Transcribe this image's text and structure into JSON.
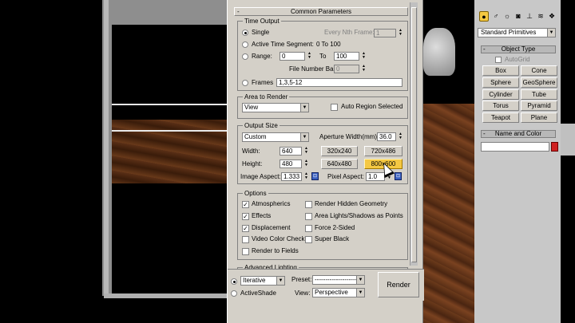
{
  "dialog": {
    "rollout_title": "Common Parameters",
    "rollout_toggle": "-",
    "time_output": {
      "title": "Time Output",
      "single": "Single",
      "every_nth_frame_label": "Every Nth Frame:",
      "every_nth_frame_value": "1",
      "active_time_segment": "Active Time Segment:",
      "active_range": "0 To 100",
      "range": "Range:",
      "range_from": "0",
      "range_to_label": "To",
      "range_to": "100",
      "file_number_base_label": "File Number Base:",
      "file_number_base_value": "0",
      "frames": "Frames",
      "frames_value": "1,3,5-12"
    },
    "area_to_render": {
      "title": "Area to Render",
      "selected": "View",
      "auto_region": "Auto Region Selected"
    },
    "output_size": {
      "title": "Output Size",
      "preset": "Custom",
      "aperture_label": "Aperture Width(mm):",
      "aperture_value": "36.0",
      "width_label": "Width:",
      "width_value": "640",
      "height_label": "Height:",
      "height_value": "480",
      "btn_320": "320x240",
      "btn_720": "720x486",
      "btn_640": "640x480",
      "btn_800": "800x600",
      "image_aspect_label": "Image Aspect:",
      "image_aspect_value": "1.333",
      "pixel_aspect_label": "Pixel Aspect:",
      "pixel_aspect_value": "1.0"
    },
    "options": {
      "title": "Options",
      "atmospherics": "Atmospherics",
      "effects": "Effects",
      "displacement": "Displacement",
      "video_color_check": "Video Color Check",
      "render_to_fields": "Render to Fields",
      "render_hidden": "Render Hidden Geometry",
      "area_lights": "Area Lights/Shadows as Points",
      "force_2sided": "Force 2-Sided",
      "super_black": "Super Black",
      "checks": {
        "atmospherics": true,
        "effects": true,
        "displacement": true,
        "video_color_check": false,
        "render_to_fields": false,
        "render_hidden": false,
        "area_lights": false,
        "force_2sided": false,
        "super_black": false
      }
    },
    "advanced_lighting": {
      "title": "Advanced Lighting"
    },
    "bottom": {
      "iterative": "Iterative",
      "activeshade": "ActiveShade",
      "preset_label": "Preset:",
      "preset_value": "--------------------",
      "view_label": "View:",
      "view_value": "Perspective",
      "render": "Render"
    }
  },
  "command_panel": {
    "icons": [
      "sphere-icon",
      "shape-icon",
      "light-icon",
      "camera-icon",
      "helper-icon",
      "spacewarp-icon",
      "system-icon"
    ],
    "category": "Standard Primitives",
    "object_type_title": "Object Type",
    "autogrid": "AutoGrid",
    "primitives": [
      "Box",
      "Cone",
      "Sphere",
      "GeoSphere",
      "Cylinder",
      "Tube",
      "Torus",
      "Pyramid",
      "Teapot",
      "Plane"
    ],
    "name_and_color_title": "Name and Color",
    "accent_color": "#d02020"
  }
}
